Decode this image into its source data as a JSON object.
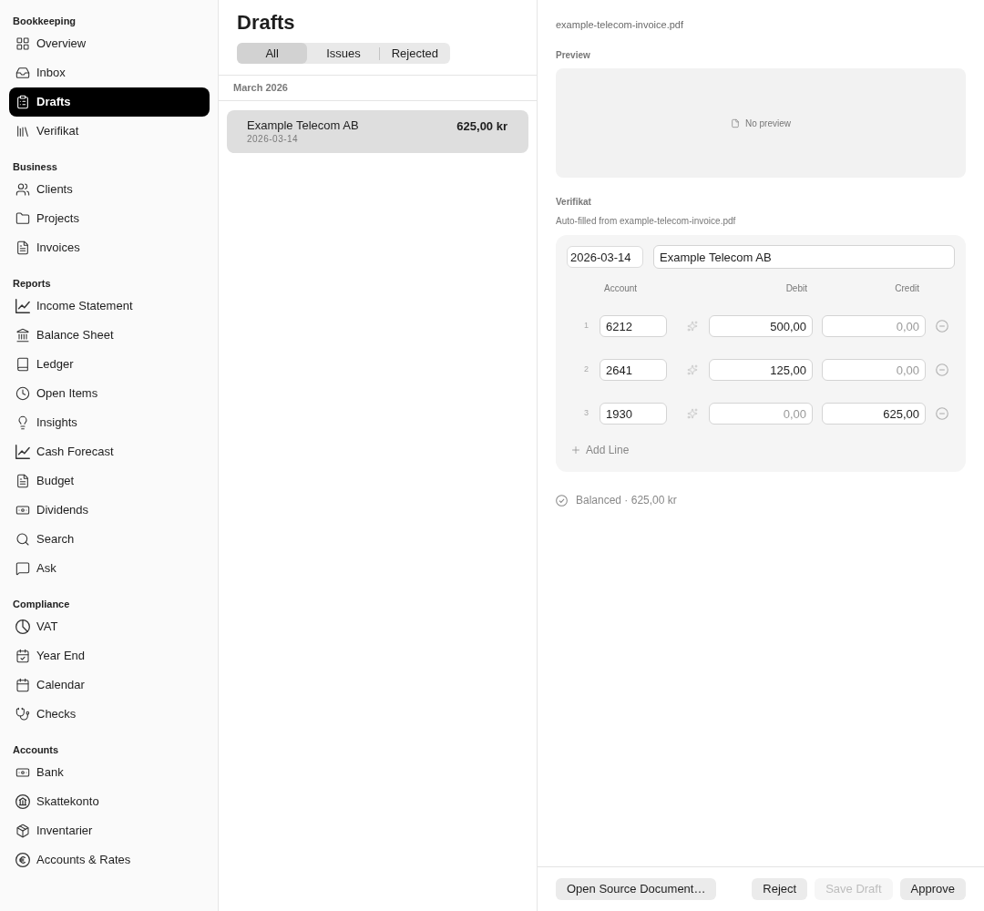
{
  "sidebar": {
    "sections": [
      {
        "heading": "Bookkeeping",
        "items": [
          {
            "label": "Overview",
            "selected": false
          },
          {
            "label": "Inbox",
            "selected": false
          },
          {
            "label": "Drafts",
            "selected": true
          },
          {
            "label": "Verifikat",
            "selected": false
          }
        ]
      },
      {
        "heading": "Business",
        "items": [
          {
            "label": "Clients",
            "selected": false
          },
          {
            "label": "Projects",
            "selected": false
          },
          {
            "label": "Invoices",
            "selected": false
          }
        ]
      },
      {
        "heading": "Reports",
        "items": [
          {
            "label": "Income Statement",
            "selected": false
          },
          {
            "label": "Balance Sheet",
            "selected": false
          },
          {
            "label": "Ledger",
            "selected": false
          },
          {
            "label": "Open Items",
            "selected": false
          },
          {
            "label": "Insights",
            "selected": false
          },
          {
            "label": "Cash Forecast",
            "selected": false
          },
          {
            "label": "Budget",
            "selected": false
          },
          {
            "label": "Dividends",
            "selected": false
          },
          {
            "label": "Search",
            "selected": false
          },
          {
            "label": "Ask",
            "selected": false
          }
        ]
      },
      {
        "heading": "Compliance",
        "items": [
          {
            "label": "VAT",
            "selected": false
          },
          {
            "label": "Year End",
            "selected": false
          },
          {
            "label": "Calendar",
            "selected": false
          },
          {
            "label": "Checks",
            "selected": false
          }
        ]
      },
      {
        "heading": "Accounts",
        "items": [
          {
            "label": "Bank",
            "selected": false
          },
          {
            "label": "Skattekonto",
            "selected": false
          },
          {
            "label": "Inventarier",
            "selected": false
          },
          {
            "label": "Accounts & Rates",
            "selected": false
          }
        ]
      }
    ]
  },
  "list_panel": {
    "title": "Drafts",
    "tabs": [
      {
        "label": "All",
        "selected": true
      },
      {
        "label": "Issues",
        "selected": false
      },
      {
        "label": "Rejected",
        "selected": false
      }
    ],
    "groups": [
      {
        "heading": "March 2026",
        "items": [
          {
            "name": "Example Telecom AB",
            "date": "2026-03-14",
            "amount": "625,00 kr",
            "selected": true
          }
        ]
      }
    ]
  },
  "detail": {
    "file_name": "example-telecom-invoice.pdf",
    "preview": {
      "heading": "Preview",
      "message": "No preview"
    },
    "verifikat": {
      "heading": "Verifikat",
      "subtitle": "Auto-filled from example-telecom-invoice.pdf",
      "date": "2026-03-14",
      "description": "Example Telecom AB",
      "columns": [
        "Account",
        "Debit",
        "Credit"
      ],
      "lines": [
        {
          "number": "1",
          "account": "6212",
          "debit": {
            "value": "500,00"
          },
          "credit": {
            "placeholder": "0,00"
          }
        },
        {
          "number": "2",
          "account": "2641",
          "debit": {
            "value": "125,00"
          },
          "credit": {
            "placeholder": "0,00"
          }
        },
        {
          "number": "3",
          "account": "1930",
          "debit": {
            "placeholder": "0,00"
          },
          "credit": {
            "value": "625,00"
          }
        }
      ],
      "add_line": "Add Line"
    },
    "status": "Balanced · 625,00 kr"
  },
  "footer": {
    "secondary_actions": [
      {
        "label": "Open Source Document…",
        "disabled": false
      }
    ],
    "actions": [
      {
        "label": "Reject",
        "disabled": false
      },
      {
        "label": "Save Draft",
        "disabled": true
      },
      {
        "label": "Approve",
        "disabled": false
      }
    ]
  }
}
